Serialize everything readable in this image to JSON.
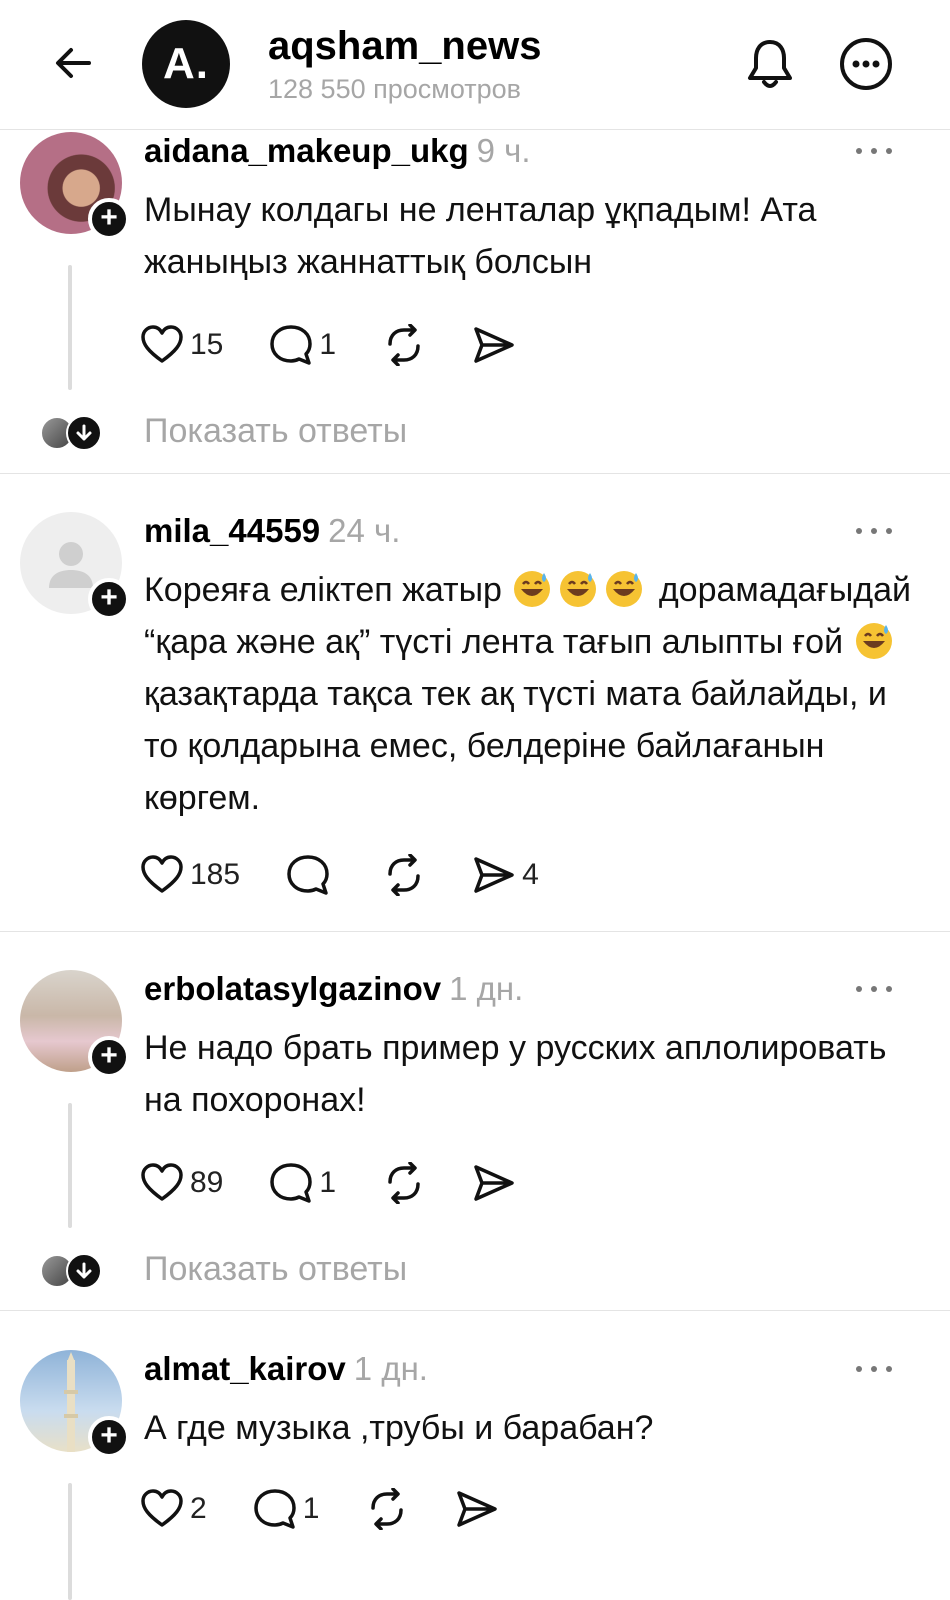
{
  "header": {
    "logo_text": "A.",
    "title": "aqsham_news",
    "subtitle": "128 550 просмотров"
  },
  "comments": [
    {
      "username": "aidana_makeup_ukg",
      "time": "9 ч.",
      "text": "Мынау колдагы не ленталар ұқпадым! Ата жаныңыз жаннаттық болсын",
      "likes": "15",
      "replies": "1",
      "shares": "",
      "show_replies": "Показать ответы"
    },
    {
      "username": "mila_44559",
      "time": "24 ч.",
      "text_part1": "Кореяға еліктеп жатыр",
      "text_part2": "дорамадағыдай “қара және ақ” түсті лента тағып алыпты ғой",
      "text_part3": "қазақтарда тақса тек ақ түсті мата байлайды, и то қолдарына емес, белдеріне байлағанын көргем.",
      "likes": "185",
      "replies": "",
      "shares": "4"
    },
    {
      "username": "erbolatasylgazinov",
      "time": "1 дн.",
      "text": "Не надо брать пример у русских аплолировать на похоронах!",
      "likes": "89",
      "replies": "1",
      "shares": "",
      "show_replies": "Показать ответы"
    },
    {
      "username": "almat_kairov",
      "time": "1 дн.",
      "text": "А где музыка ,трубы и барабан?",
      "likes": "2",
      "replies": "1",
      "shares": ""
    }
  ],
  "icons": {
    "back": "arrow-left-icon",
    "bell": "bell-icon",
    "more": "more-circle-icon",
    "like": "heart-icon",
    "reply": "comment-icon",
    "repost": "repost-icon",
    "share": "send-icon",
    "emoji": "grinning-sweat-emoji"
  },
  "colors": {
    "muted": "#a6a6a6",
    "divider": "#e4e4e4",
    "badge": "#111111"
  }
}
